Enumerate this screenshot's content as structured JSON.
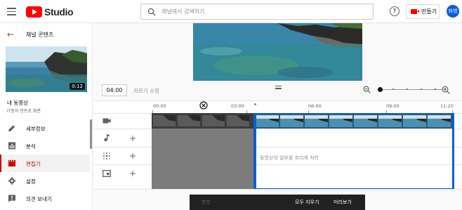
{
  "app": {
    "brand": "Studio",
    "search_placeholder": "채널에서 검색하기",
    "help_glyph": "?",
    "create_label": "만들기",
    "avatar_text": "화영"
  },
  "sidebar": {
    "back_title": "채널 콘텐츠",
    "video_duration": "0:12",
    "video_title": "내 동영상",
    "video_subtitle": "IT동아 인트로 화면",
    "items": [
      {
        "label": "세부정보",
        "icon": "pencil-icon"
      },
      {
        "label": "분석",
        "icon": "analytics-icon"
      },
      {
        "label": "편집기",
        "icon": "film-icon",
        "active": true
      },
      {
        "label": "설정",
        "icon": "gear-icon"
      },
      {
        "label": "의견 보내기",
        "icon": "feedback-icon"
      }
    ]
  },
  "editor": {
    "current_time": "04:00",
    "trim_label": "자르기 수정",
    "zoom_level": 0
  },
  "timeline": {
    "ruler": [
      "00:00",
      "03:00",
      "06:00",
      "09:00",
      "11:20"
    ],
    "hint": "동영상의 일부를 흐리게 처리"
  },
  "action_bar": {
    "split": "분할",
    "clear_all": "모두 지우기",
    "preview": "미리보기"
  },
  "colors": {
    "brand_red": "#ff0000",
    "selection_blue": "#065fd4",
    "active_nav": "#cc0000",
    "avatar_bg": "#065fd4"
  }
}
